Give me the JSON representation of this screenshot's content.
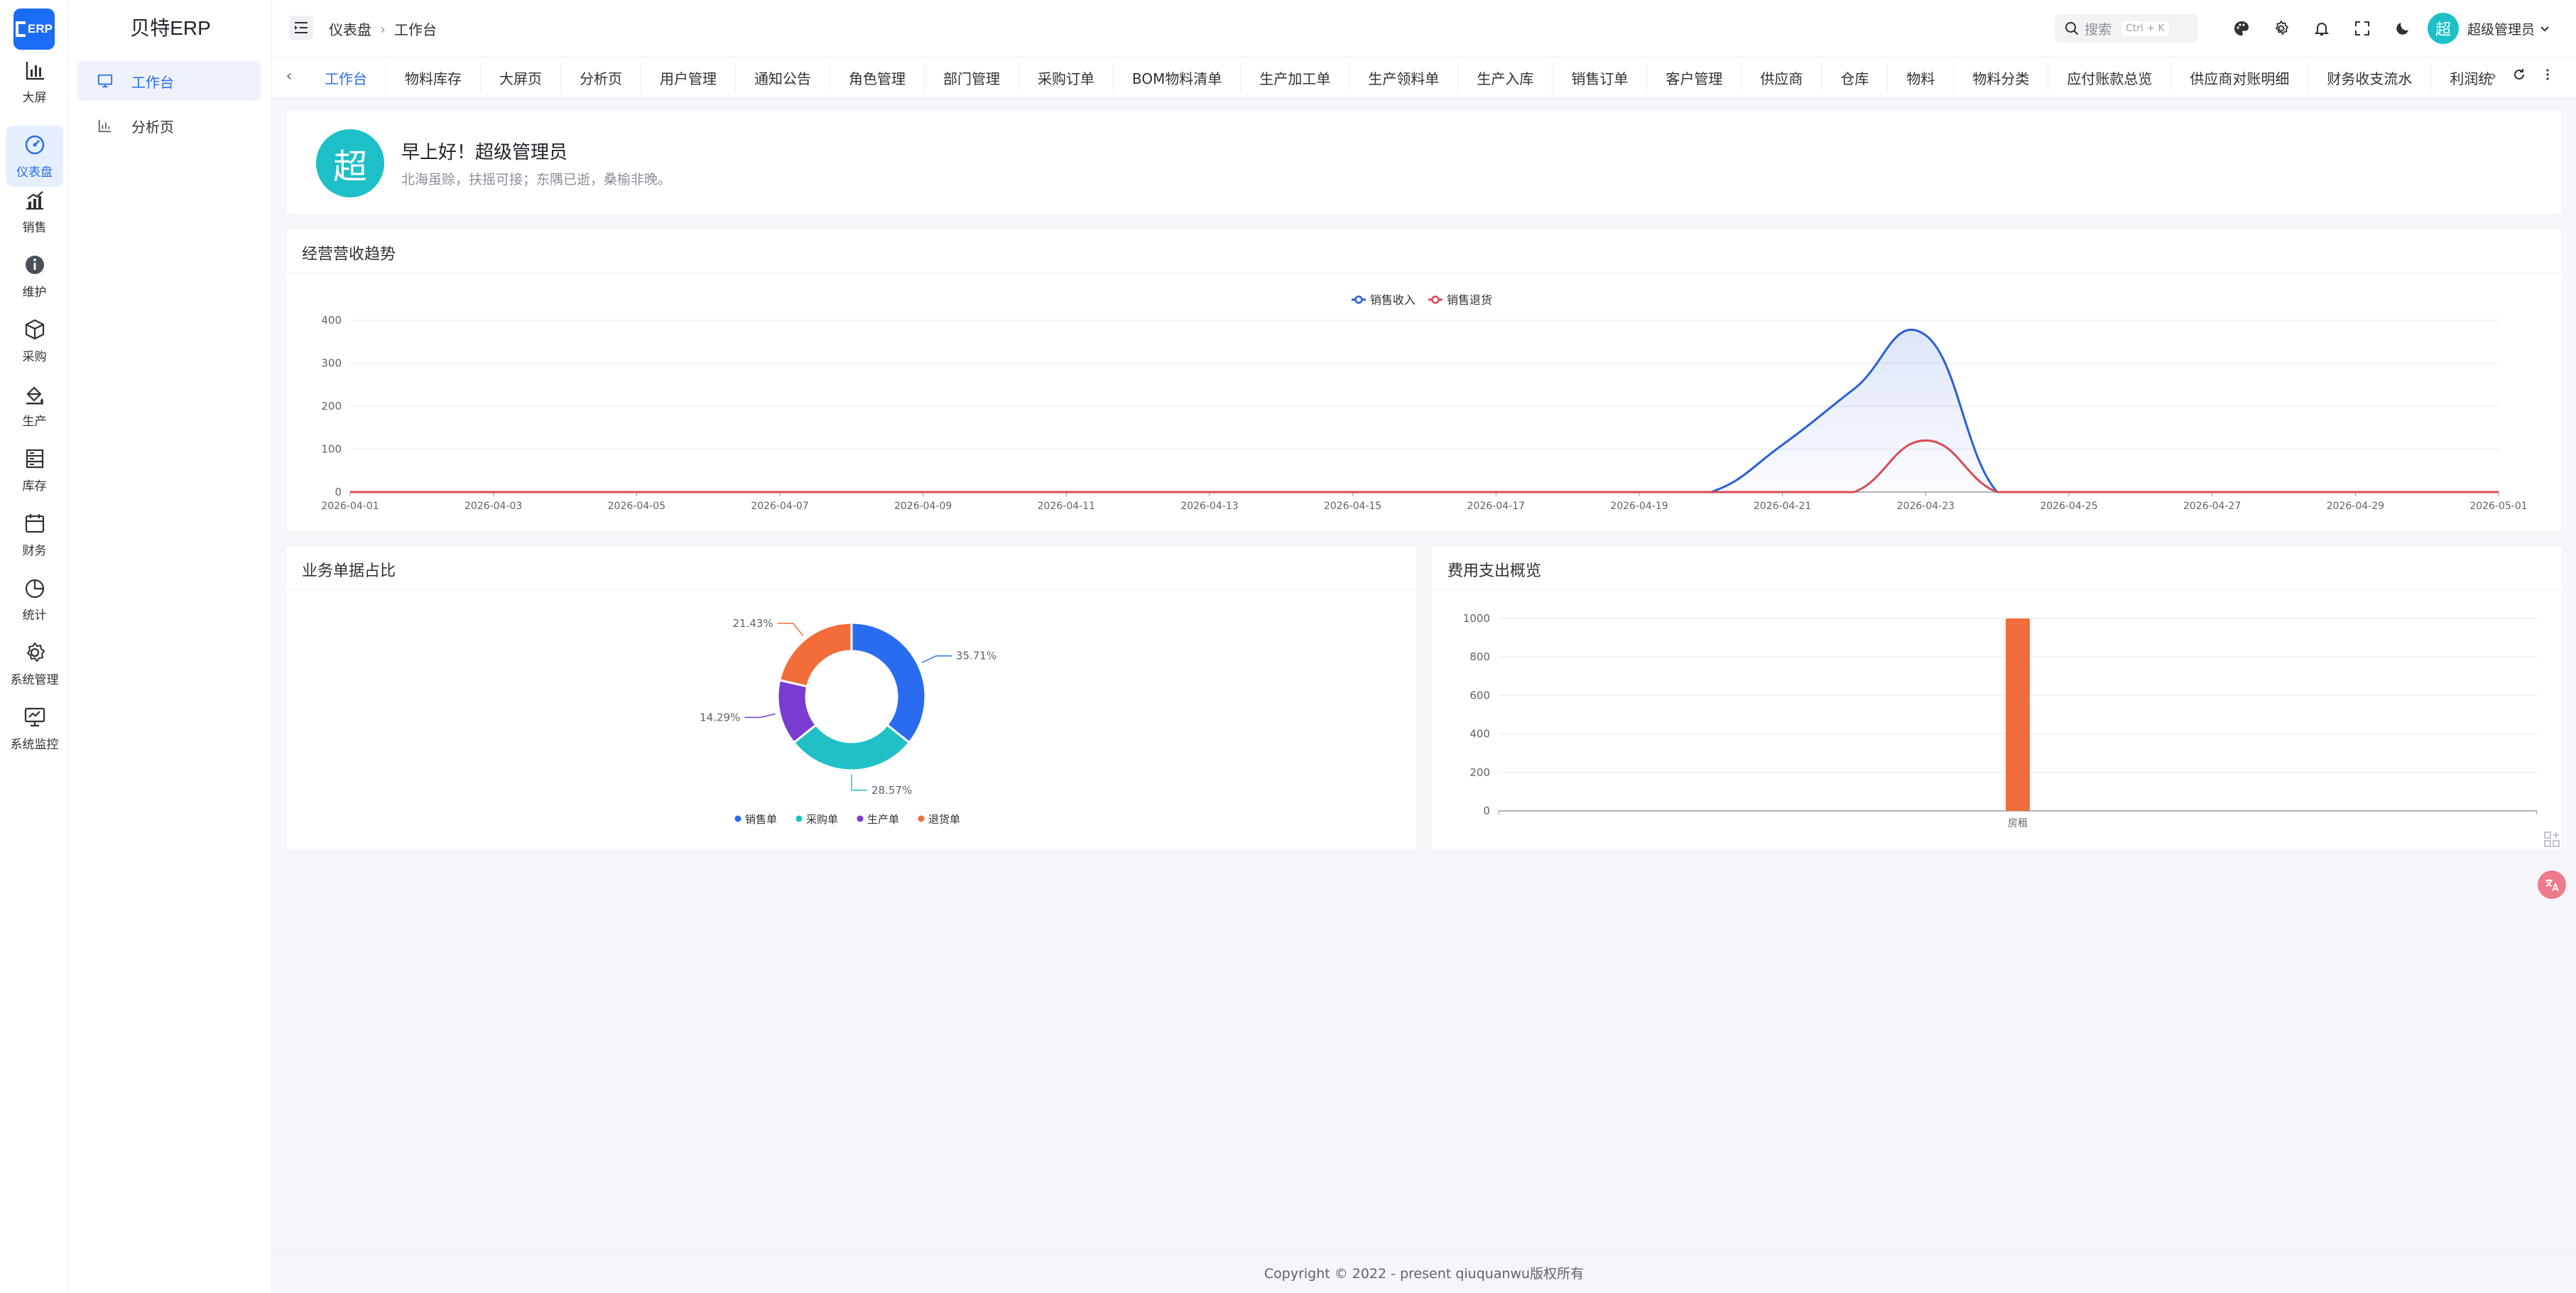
{
  "app": {
    "brand": "贝特ERP",
    "logo_text": "ERP"
  },
  "rail": {
    "items": [
      {
        "label": "大屏",
        "icon": "bar-chart-icon"
      },
      {
        "label": "仪表盘",
        "icon": "dashboard-icon",
        "active": true
      },
      {
        "label": "销售",
        "icon": "trend-up-icon"
      },
      {
        "label": "维护",
        "icon": "info-icon"
      },
      {
        "label": "采购",
        "icon": "box-icon"
      },
      {
        "label": "生产",
        "icon": "paint-bucket-icon"
      },
      {
        "label": "库存",
        "icon": "warehouse-icon"
      },
      {
        "label": "财务",
        "icon": "calendar-icon"
      },
      {
        "label": "统计",
        "icon": "pie-icon"
      },
      {
        "label": "系统管理",
        "icon": "gear-icon"
      },
      {
        "label": "系统监控",
        "icon": "monitor-icon"
      }
    ]
  },
  "submenu": {
    "items": [
      {
        "label": "工作台",
        "icon": "desktop-icon",
        "active": true
      },
      {
        "label": "分析页",
        "icon": "bar-chart-icon"
      }
    ]
  },
  "header": {
    "breadcrumb": [
      "仪表盘",
      "工作台"
    ],
    "search_label": "搜索",
    "search_shortcut": "Ctrl + K",
    "user_name": "超级管理员",
    "avatar_char": "超"
  },
  "tabs": [
    "工作台",
    "物料库存",
    "大屏页",
    "分析页",
    "用户管理",
    "通知公告",
    "角色管理",
    "部门管理",
    "采购订单",
    "BOM物料清单",
    "生产加工单",
    "生产领料单",
    "生产入库",
    "销售订单",
    "客户管理",
    "供应商",
    "仓库",
    "物料",
    "物料分类",
    "应付账款总览",
    "供应商对账明细",
    "财务收支流水",
    "利润统"
  ],
  "welcome": {
    "avatar_char": "超",
    "greeting": "早上好！超级管理员",
    "motto": "北海虽赊，扶摇可接；东隅已逝，桑榆非晚。"
  },
  "cards": {
    "trend_title": "经营营收趋势",
    "pie_title": "业务单据占比",
    "bar_title": "费用支出概览"
  },
  "colors": {
    "blue": "#2a5fd6",
    "red": "#d94b57",
    "teal": "#21c0c7",
    "purple": "#7a3bd1",
    "orange": "#f26d3a",
    "primary": "#2a6cf0"
  },
  "chart_data": [
    {
      "type": "line",
      "legend_position": "top-center",
      "x": [
        "2026-04-01",
        "2026-04-02",
        "2026-04-03",
        "2026-04-04",
        "2026-04-05",
        "2026-04-06",
        "2026-04-07",
        "2026-04-08",
        "2026-04-09",
        "2026-04-10",
        "2026-04-11",
        "2026-04-12",
        "2026-04-13",
        "2026-04-14",
        "2026-04-15",
        "2026-04-16",
        "2026-04-17",
        "2026-04-18",
        "2026-04-19",
        "2026-04-20",
        "2026-04-21",
        "2026-04-22",
        "2026-04-23",
        "2026-04-24",
        "2026-04-25",
        "2026-04-26",
        "2026-04-27",
        "2026-04-28",
        "2026-04-29",
        "2026-04-30",
        "2026-05-01"
      ],
      "x_ticks": [
        "2026-04-01",
        "2026-04-03",
        "2026-04-05",
        "2026-04-07",
        "2026-04-09",
        "2026-04-11",
        "2026-04-13",
        "2026-04-15",
        "2026-04-17",
        "2026-04-19",
        "2026-04-21",
        "2026-04-23",
        "2026-04-25",
        "2026-04-27",
        "2026-04-29",
        "2026-05-01"
      ],
      "ylim": [
        0,
        400
      ],
      "y_ticks": [
        0,
        100,
        200,
        300,
        400
      ],
      "grid": true,
      "series": [
        {
          "name": "销售收入",
          "values": [
            0,
            0,
            0,
            0,
            0,
            0,
            0,
            0,
            0,
            0,
            0,
            0,
            0,
            0,
            0,
            0,
            0,
            0,
            0,
            0,
            110,
            240,
            365,
            0,
            0,
            0,
            0,
            0,
            0,
            0,
            0
          ]
        },
        {
          "name": "销售退货",
          "values": [
            0,
            0,
            0,
            0,
            0,
            0,
            0,
            0,
            0,
            0,
            0,
            0,
            0,
            0,
            0,
            0,
            0,
            0,
            0,
            0,
            0,
            0,
            120,
            0,
            0,
            0,
            0,
            0,
            0,
            0,
            0
          ]
        }
      ]
    },
    {
      "type": "pie",
      "donut": true,
      "legend_position": "bottom",
      "labels": [
        "销售单",
        "采购单",
        "生产单",
        "退货单"
      ],
      "values": [
        35.71,
        28.57,
        14.29,
        21.43
      ],
      "value_labels": [
        "35.71%",
        "28.57%",
        "14.29%",
        "21.43%"
      ]
    },
    {
      "type": "bar",
      "categories": [
        "房租"
      ],
      "values": [
        1000
      ],
      "ylim": [
        0,
        1000
      ],
      "y_ticks": [
        0,
        200,
        400,
        600,
        800,
        1000
      ],
      "grid": true
    }
  ],
  "footer": {
    "text": "Copyright © 2022 - present qiuquanwu版权所有"
  }
}
